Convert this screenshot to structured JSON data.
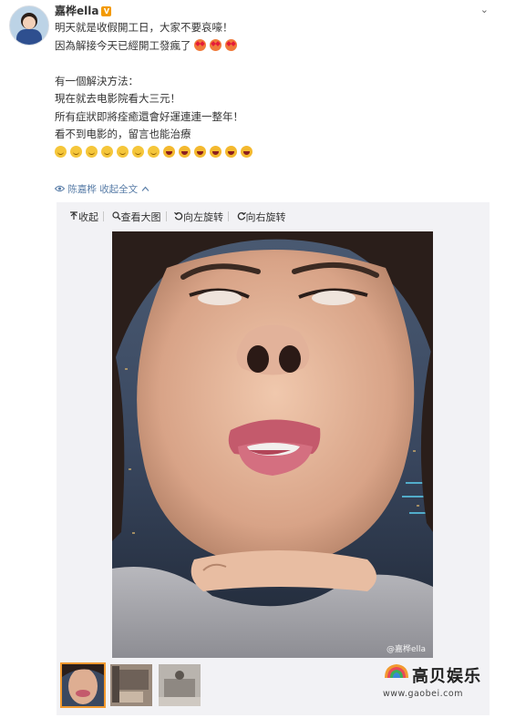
{
  "post": {
    "author": "嘉桦ella",
    "verified_badge": "V",
    "menu_glyph": "⌄",
    "lines": [
      "明天就是收假開工日，大家不要哀嚎！",
      "因為解接今天已經開工發瘋了",
      "",
      "有一個解決方法：",
      "現在就去电影院看大三元！",
      "所有症狀即將痊癒還會好運連連一整年！",
      "看不到电影的，留言也能治療"
    ],
    "meta": {
      "author_link": "陈嘉桦",
      "collapse_label": "收起全文"
    }
  },
  "media": {
    "toolbar": {
      "collapse": "收起",
      "view_large": "查看大图",
      "rotate_left": "向左旋转",
      "rotate_right": "向右旋转"
    },
    "photo_watermark": "@嘉桦ella",
    "thumb_count": 3
  },
  "site_watermark": {
    "name": "高贝娱乐",
    "url": "www.gaobei.com"
  },
  "colors": {
    "link": "#5a7ea8",
    "media_bg": "#f2f2f5",
    "active_thumb": "#f29a30",
    "verified": "#f39a00"
  },
  "icons": [
    "chevron-down-icon",
    "eye-icon",
    "chevron-up-icon",
    "collapse-icon",
    "zoom-icon",
    "rotate-left-icon",
    "rotate-right-icon",
    "smile-emoji-icon",
    "heart-eyes-emoji-icon",
    "laugh-emoji-icon",
    "site-logo-icon"
  ]
}
